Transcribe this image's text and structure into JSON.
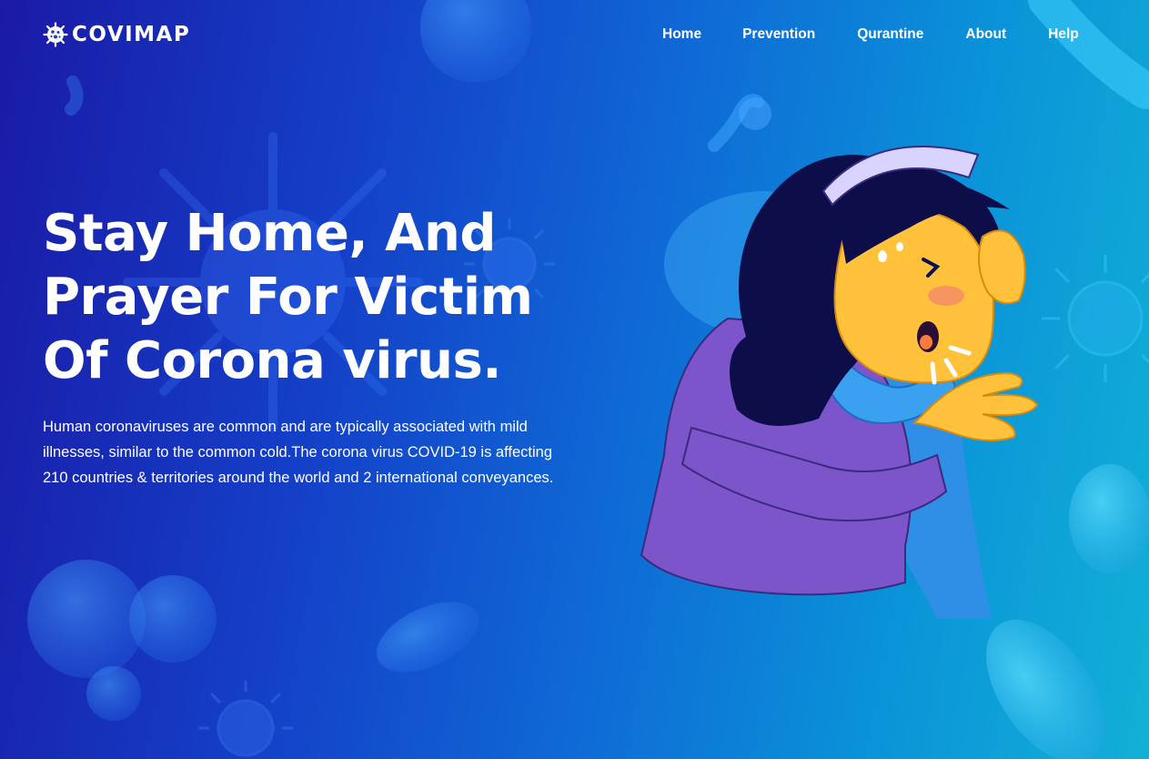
{
  "brand": {
    "name": "COVIMAP",
    "logo_icon": "virus-icon"
  },
  "nav": {
    "items": [
      {
        "label": "Home"
      },
      {
        "label": "Prevention"
      },
      {
        "label": "Qurantine"
      },
      {
        "label": "About"
      },
      {
        "label": "Help"
      }
    ]
  },
  "hero": {
    "title_lines": [
      "Stay Home, And",
      "Prayer For Victim",
      "Of Corona virus."
    ],
    "description": "Human coronaviruses are common and are typically associated with mild illnesses, similar to the common cold.The corona virus COVID-19 is affecting 210 countries & territories around the world and 2 international conveyances."
  },
  "illustration": {
    "subject": "sick-woman-coughing-illustration"
  },
  "colors": {
    "bg_left": "#1a1aa6",
    "bg_mid": "#0f6ad6",
    "bg_right": "#12b0d6",
    "sweater": "#7b55c9",
    "skin": "#ffc23a",
    "hair": "#0d0d4a",
    "scarf": "#2f8fe6"
  }
}
